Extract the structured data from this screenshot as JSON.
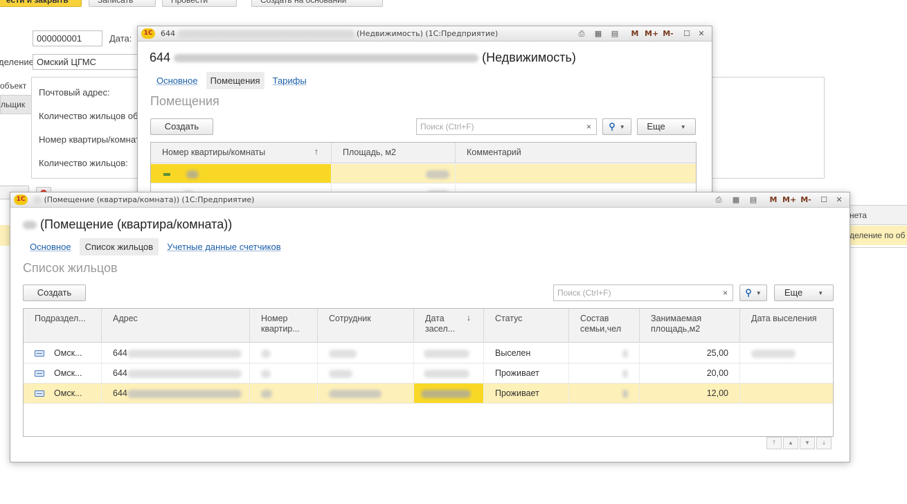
{
  "base": {
    "toolbar": {
      "post_close": "ести и закрыть",
      "save": "Записать",
      "post": "Провести",
      "create_based": "Создать на основании"
    },
    "number_value": "000000001",
    "date_label": "Дата:",
    "division_label": "деление:",
    "division_value": "Омский ЦГМС",
    "side_tabs": [
      "объект",
      "льщик"
    ],
    "fields": [
      "Почтовый адрес:",
      "Количество жильцов об",
      "Номер квартиры/комнат",
      "Количество жильцов:"
    ],
    "right_col_header": "нета",
    "right_col_value": "деление по об"
  },
  "realty": {
    "title_prefix": "644",
    "title_suffix": "(Недвижимость) (1С:Предприятие)",
    "heading_prefix": "644",
    "heading_suffix": "(Недвижимость)",
    "tabs": [
      "Основное",
      "Помещения",
      "Тарифы"
    ],
    "active_tab": "Помещения",
    "section": "Помещения",
    "create": "Создать",
    "search_placeholder": "Поиск (Ctrl+F)",
    "more": "Еще",
    "columns": [
      "Номер квартиры/комнаты",
      "Площадь, м2",
      "Комментарий"
    ]
  },
  "room": {
    "title": "(Помещение (квартира/комната)) (1С:Предприятие)",
    "heading": "(Помещение (квартира/комната))",
    "tabs": [
      "Основное",
      "Список жильцов",
      "Учетные данные счетчиков"
    ],
    "active_tab": "Список жильцов",
    "section": "Список жильцов",
    "create": "Создать",
    "search_placeholder": "Поиск (Ctrl+F)",
    "more": "Еще",
    "columns": [
      "Подраздел...",
      "Адрес",
      "Номер квартир...",
      "Сотрудник",
      "Дата засел...",
      "Статус",
      "Состав семьи,чел",
      "Занимаемая площадь,м2",
      "Дата выселения"
    ],
    "rows": [
      {
        "division": "Омск...",
        "address_prefix": "644",
        "status": "Выселен",
        "area": "25,00"
      },
      {
        "division": "Омск...",
        "address_prefix": "644",
        "status": "Проживает",
        "area": "20,00"
      },
      {
        "division": "Омск...",
        "address_prefix": "644",
        "status": "Проживает",
        "area": "12,00"
      }
    ]
  },
  "window_buttons": {
    "m": "M",
    "mplus": "M+",
    "mminus": "M-",
    "maximize": "☐",
    "close": "✕"
  },
  "icons": {
    "logo": "1С",
    "sort_up": "↑",
    "sort_down": "↓",
    "dropdown": "▼",
    "clear": "×",
    "search": "⚲",
    "nav": [
      "⤒",
      "▲",
      "▼",
      "⤓"
    ]
  }
}
